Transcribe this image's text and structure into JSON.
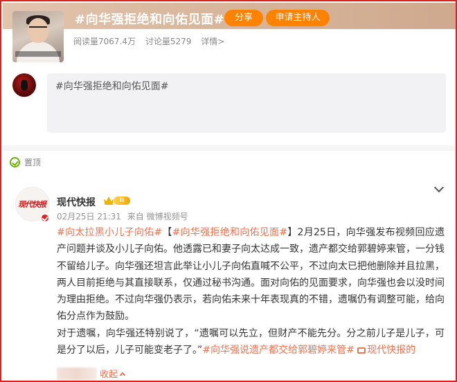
{
  "header": {
    "topic_title": "#向华强拒绝和向佑见面#",
    "share_label": "分享",
    "host_label": "申请主持人",
    "reads": "阅读量7067.4万",
    "discussions": "讨论量5279",
    "details": "详情>"
  },
  "compose": {
    "text": "#向华强拒绝和向佑见面#"
  },
  "pinned": {
    "label": "置顶"
  },
  "post": {
    "author": "现代快报",
    "member_level": "II",
    "avatar_logo_text": "现代快报",
    "date": "02月25日 21:31",
    "from": "来自 微博视频号",
    "tag1": "#向太拉黑小儿子向佑#",
    "bracket_open": "【",
    "tag2": "#向华强拒绝和向佑见面#",
    "bracket_close": "】",
    "para1_text": "2月25日，向华强发布视频回应遗产问题并谈及小儿子向佑。他透露已和妻子向太达成一致，遗产都交给郭碧婷来管，一分钱不留给儿子。向华强还坦言此举让小儿子向佑直喊不公平，不过向太已把他删除并且拉黑，两人目前拒绝与其直接联系，仅通过秘书沟通。面对向佑的见面要求，向华强也会以没时间为理由拒绝。不过向华强仍表示，若向佑未来十年表现真的不错，遗嘱仍有调整可能，给向佑分点作为鼓励。",
    "para2_text": "对于遗嘱，向华强还特别说了，“遗嘱可以先立，但财产不能先分。分之前儿子是儿子，可是分了以后，儿子可能变老子了。”",
    "tag3": "#向华强说遗产都交给郭碧婷来管#",
    "source_label": "现代快报的",
    "collapse_label": "收起"
  },
  "colors": {
    "frame": "#e0201c",
    "accent_orange": "#ff8200",
    "link": "#eb7350",
    "pin_green": "#67b300"
  }
}
